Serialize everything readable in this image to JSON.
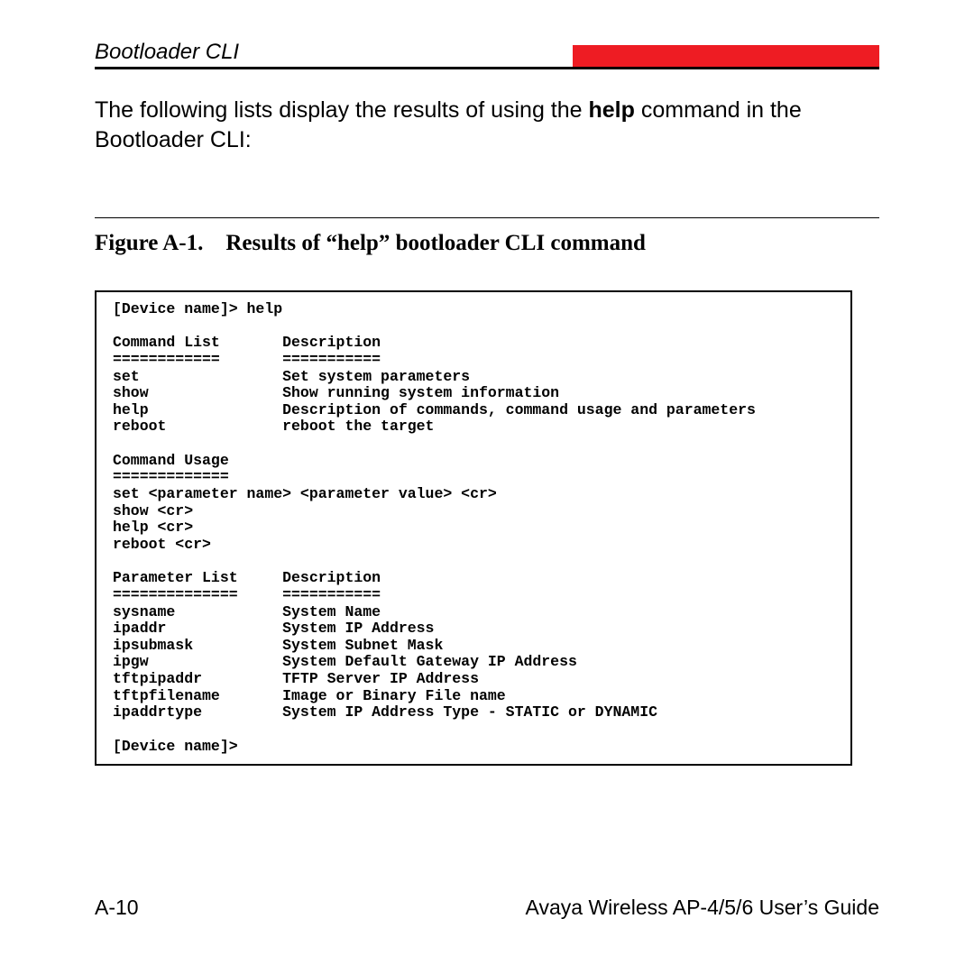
{
  "header": {
    "title": "Bootloader CLI"
  },
  "intro": {
    "prefix": "The following lists display the results of using the ",
    "bold": "help",
    "suffix": " command in the Bootloader CLI:"
  },
  "figure": {
    "caption": "Figure A-1. Results of “help” bootloader CLI command"
  },
  "cli": {
    "text": "[Device name]> help\n\nCommand List       Description\n============       ===========\nset                Set system parameters\nshow               Show running system information\nhelp               Description of commands, command usage and parameters\nreboot             reboot the target\n\nCommand Usage\n=============\nset <parameter name> <parameter value> <cr>\nshow <cr>\nhelp <cr>\nreboot <cr>\n\nParameter List     Description\n==============     ===========\nsysname            System Name\nipaddr             System IP Address\nipsubmask          System Subnet Mask\nipgw               System Default Gateway IP Address\ntftpipaddr         TFTP Server IP Address\ntftpfilename       Image or Binary File name\nipaddrtype         System IP Address Type - STATIC or DYNAMIC\n\n[Device name]>"
  },
  "footer": {
    "page": "A-10",
    "guide": "Avaya Wireless AP-4/5/6 User’s Guide"
  }
}
